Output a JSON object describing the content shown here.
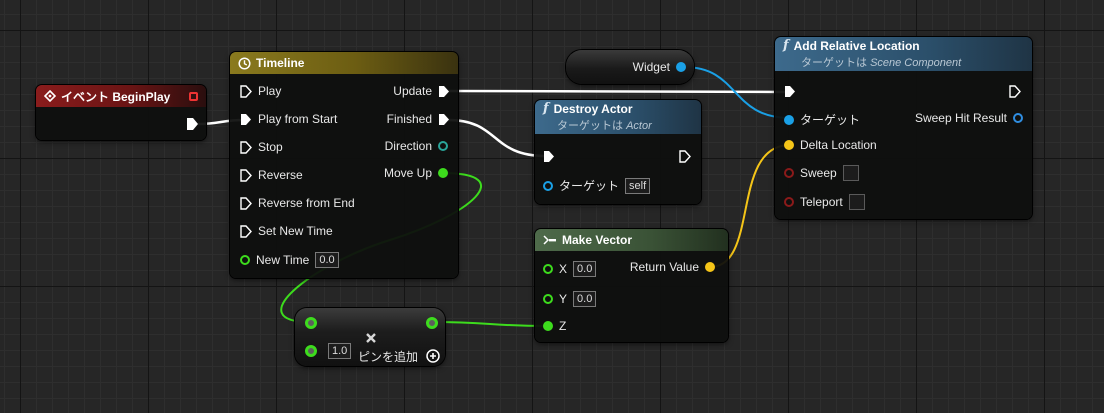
{
  "begin_play": {
    "title": "イベント BeginPlay"
  },
  "timeline": {
    "title": "Timeline",
    "inputs": [
      "Play",
      "Play from Start",
      "Stop",
      "Reverse",
      "Reverse from End",
      "Set New Time"
    ],
    "new_time_label": "New Time",
    "new_time_value": "0.0",
    "outputs": [
      "Update",
      "Finished",
      "Direction",
      "Move Up"
    ]
  },
  "widget": {
    "label": "Widget"
  },
  "destroy_actor": {
    "title": "Destroy Actor",
    "subtitle_prefix": "ターゲットは",
    "subtitle_class": "Actor",
    "target_label": "ターゲット",
    "target_value": "self"
  },
  "add_relative_location": {
    "title": "Add Relative Location",
    "subtitle_prefix": "ターゲットは",
    "subtitle_class": "Scene Component",
    "target_label": "ターゲット",
    "delta_location_label": "Delta Location",
    "sweep_label": "Sweep",
    "teleport_label": "Teleport",
    "sweep_hit_result_label": "Sweep Hit Result"
  },
  "make_vector": {
    "title": "Make Vector",
    "x_label": "X",
    "x_value": "0.0",
    "y_label": "Y",
    "y_value": "0.0",
    "z_label": "Z",
    "return_label": "Return Value"
  },
  "multiply": {
    "value": "1.0",
    "add_pin_label": "ピンを追加"
  },
  "colors": {
    "exec": "#ffffff",
    "object": "#1aa0e6",
    "float": "#3ddc1d",
    "vector": "#f5c518",
    "struct": "#2f8de0",
    "bool": "#8b1a1a",
    "teal": "#2aa59a"
  }
}
